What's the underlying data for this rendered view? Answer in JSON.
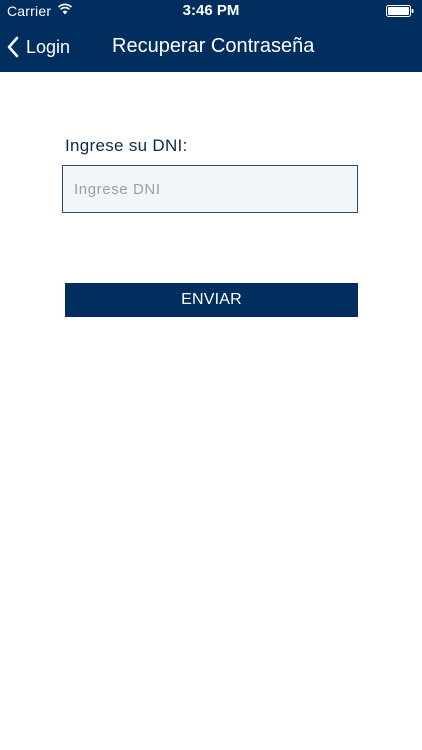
{
  "status_bar": {
    "carrier": "Carrier",
    "time": "3:46 PM",
    "wifi_icon": "wifi-icon",
    "battery_icon": "battery-icon"
  },
  "nav": {
    "back_label": "Login",
    "back_icon": "chevron-left-icon",
    "title": "Recuperar Contraseña"
  },
  "form": {
    "dni_label": "Ingrese su DNI:",
    "dni_value": "",
    "dni_placeholder": "Ingrese DNI",
    "submit_label": "ENVIAR"
  },
  "colors": {
    "brand": "#002f5f",
    "input_background": "#f2f5f8",
    "label_text": "#0c2a4f"
  }
}
